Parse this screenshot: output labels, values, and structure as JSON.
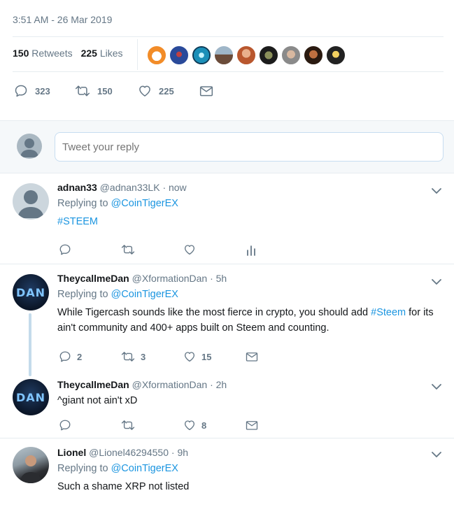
{
  "tweet": {
    "timestamp": "3:51 AM - 26 Mar 2019",
    "retweets_count": "150",
    "retweets_label": "Retweets",
    "likes_count": "225",
    "likes_label": "Likes",
    "actions": {
      "replies": "323",
      "retweets": "150",
      "likes": "225"
    }
  },
  "reply_box": {
    "placeholder": "Tweet your reply"
  },
  "replies": [
    {
      "name": "adnan33",
      "handle": "@adnan33LK",
      "time": "· now",
      "replying_label": "Replying to",
      "replying_to": "@CoinTigerEX",
      "text": "#STEEM"
    },
    {
      "name": "TheycallmeDan",
      "handle": "@XformationDan",
      "time": "· 5h",
      "replying_label": "Replying to",
      "replying_to": "@CoinTigerEX",
      "text_before": "While Tigercash sounds like the most fierce in crypto, you should add",
      "text_link": "#Steem",
      "text_after": "for its ain't community and 400+ apps built on Steem and counting.",
      "avatar_text": "DAN",
      "actions": {
        "replies": "2",
        "retweets": "3",
        "likes": "15"
      }
    },
    {
      "name": "TheycallmeDan",
      "handle": "@XformationDan",
      "time": "· 2h",
      "text": "^giant not ain't xD",
      "avatar_text": "DAN",
      "actions": {
        "likes": "8"
      }
    },
    {
      "name": "Lionel",
      "handle": "@Lionel46294550",
      "time": "· 9h",
      "replying_label": "Replying to",
      "replying_to": "@CoinTigerEX",
      "text": "Such a shame XRP not listed"
    }
  ],
  "colors": {
    "link": "#1b95e0",
    "muted": "#657786",
    "divider": "#e6ecf0"
  }
}
